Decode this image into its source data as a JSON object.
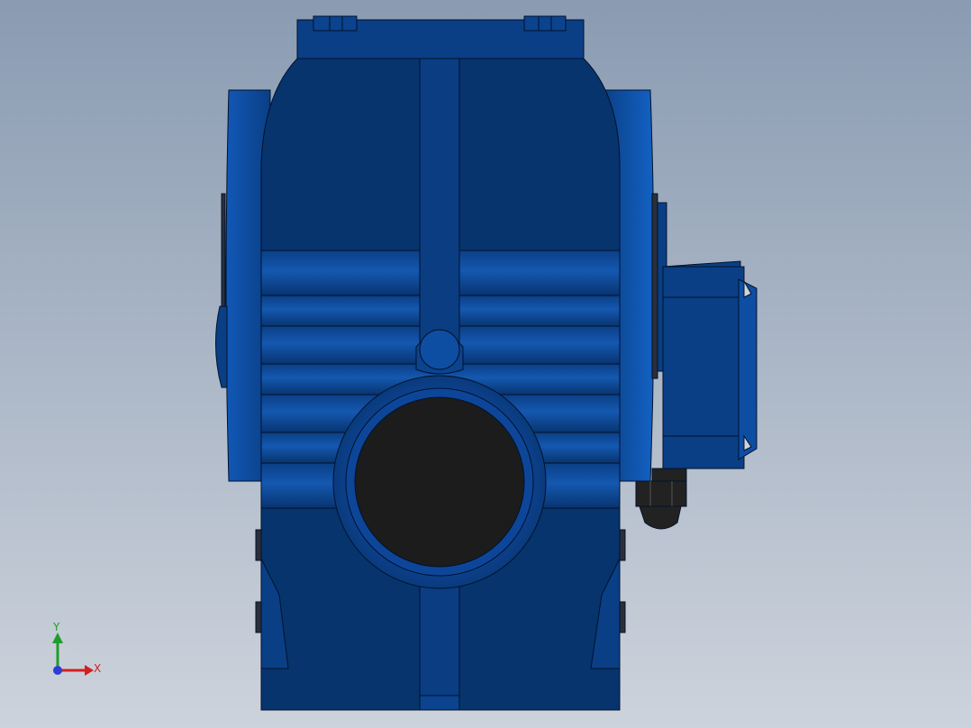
{
  "scene": {
    "subject": "gearbox-front-view",
    "colors": {
      "background_top": "#8a9bb2",
      "background_bottom": "#cdd3dc",
      "body_dark": "#07346d",
      "body_mid": "#0a3f86",
      "body_light": "#1158b6",
      "outline": "#02122b",
      "shaft_bore": "#1c1c1c",
      "nut": "#222222",
      "axis_x": "#d21f1f",
      "axis_y": "#1f9d2a",
      "axis_z": "#2a3fd6"
    }
  },
  "triad": {
    "x_label": "X",
    "y_label": "Y"
  }
}
